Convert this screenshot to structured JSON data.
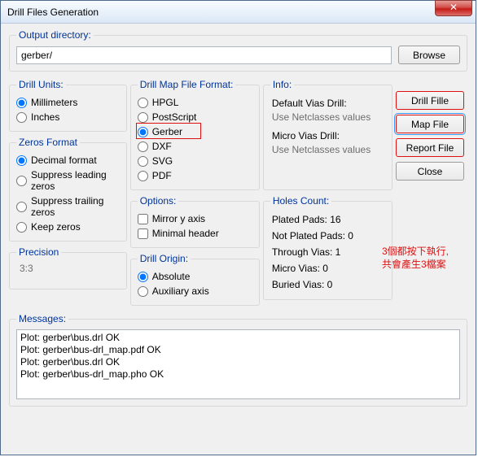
{
  "window": {
    "title": "Drill Files Generation"
  },
  "output": {
    "legend": "Output directory:",
    "value": "gerber/",
    "browse": "Browse"
  },
  "drill_units": {
    "legend": "Drill Units:",
    "millimeters": "Millimeters",
    "inches": "Inches",
    "selected": "Millimeters"
  },
  "zeros": {
    "legend": "Zeros Format",
    "decimal": "Decimal format",
    "sup_lead": "Suppress leading zeros",
    "sup_trail": "Suppress trailing zeros",
    "keep": "Keep zeros",
    "selected": "Decimal format"
  },
  "precision": {
    "legend": "Precision",
    "value": "3:3"
  },
  "map_format": {
    "legend": "Drill Map File Format:",
    "hpgl": "HPGL",
    "postscript": "PostScript",
    "gerber": "Gerber",
    "dxf": "DXF",
    "svg": "SVG",
    "pdf": "PDF",
    "selected": "Gerber"
  },
  "options": {
    "legend": "Options:",
    "mirror": "Mirror y axis",
    "minimal": "Minimal header"
  },
  "origin": {
    "legend": "Drill Origin:",
    "absolute": "Absolute",
    "aux": "Auxiliary axis",
    "selected": "Absolute"
  },
  "info": {
    "legend": "Info:",
    "default_vias": "Default Vias Drill:",
    "use_netclasses": "Use Netclasses values",
    "micro_vias": "Micro Vias Drill:",
    "use_netclasses2": "Use Netclasses values"
  },
  "holes": {
    "legend": "Holes Count:",
    "plated": "Plated Pads: 16",
    "not_plated": "Not Plated Pads: 0",
    "through": "Through Vias: 1",
    "micro": "Micro Vias: 0",
    "buried": "Buried Vias: 0"
  },
  "buttons": {
    "drill": "Drill Fille",
    "map": "Map File",
    "report": "Report File",
    "close": "Close"
  },
  "annotation": {
    "line1": "3個都按下執行,",
    "line2": "共會產生3檔案"
  },
  "messages": {
    "legend": "Messages:",
    "lines": [
      "Plot: gerber\\bus.drl OK",
      "Plot: gerber\\bus-drl_map.pdf OK",
      "Plot: gerber\\bus.drl OK",
      "Plot: gerber\\bus-drl_map.pho OK"
    ]
  }
}
